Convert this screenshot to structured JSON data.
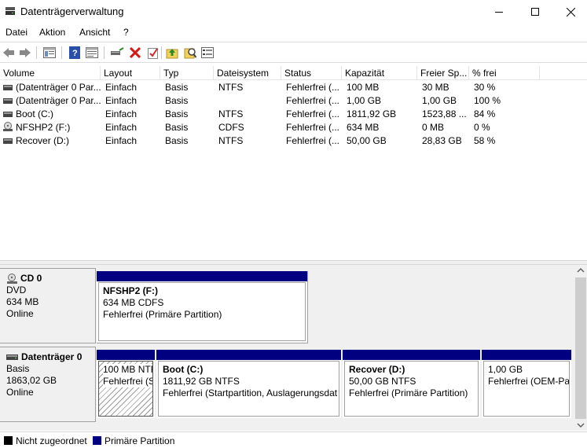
{
  "window": {
    "title": "Datenträgerverwaltung",
    "controls": [
      "minimize",
      "maximize",
      "close"
    ]
  },
  "menu": [
    "Datei",
    "Aktion",
    "Ansicht",
    "?"
  ],
  "toolbar": {
    "icons": [
      "back-icon",
      "forward-icon",
      "console-tree-icon",
      "help-icon",
      "properties-view-icon",
      "connect-disk-icon",
      "delete-icon",
      "check-icon",
      "rescan-up-icon",
      "search-icon",
      "settings-list-icon"
    ]
  },
  "volume_list": {
    "columns": [
      "Volume",
      "Layout",
      "Typ",
      "Dateisystem",
      "Status",
      "Kapazität",
      "Freier Sp...",
      "% frei"
    ],
    "rows": [
      {
        "icon": "drive-icon",
        "cells": [
          "(Datenträger 0 Par...",
          "Einfach",
          "Basis",
          "NTFS",
          "Fehlerfrei (...",
          "100 MB",
          "30 MB",
          "30 %"
        ]
      },
      {
        "icon": "drive-icon",
        "cells": [
          "(Datenträger 0 Par...",
          "Einfach",
          "Basis",
          "",
          "Fehlerfrei (...",
          "1,00 GB",
          "1,00 GB",
          "100 %"
        ]
      },
      {
        "icon": "drive-icon",
        "cells": [
          "Boot (C:)",
          "Einfach",
          "Basis",
          "NTFS",
          "Fehlerfrei (...",
          "1811,92 GB",
          "1523,88 ...",
          "84 %"
        ]
      },
      {
        "icon": "cd-drive-icon",
        "cells": [
          "NFSHP2 (F:)",
          "Einfach",
          "Basis",
          "CDFS",
          "Fehlerfrei (...",
          "634 MB",
          "0 MB",
          "0 %"
        ]
      },
      {
        "icon": "drive-icon",
        "cells": [
          "Recover (D:)",
          "Einfach",
          "Basis",
          "NTFS",
          "Fehlerfrei (...",
          "50,00 GB",
          "28,83 GB",
          "58 %"
        ]
      }
    ]
  },
  "disks": [
    {
      "name": "CD 0",
      "icon": "cd-icon",
      "lines": [
        "DVD",
        "634 MB",
        "Online"
      ],
      "partitions": [
        {
          "title": "NFSHP2  (F:)",
          "size": "634 MB CDFS",
          "status": "Fehlerfrei (Primäre Partition)"
        }
      ]
    },
    {
      "name": "Datenträger 0",
      "icon": "disk-icon",
      "lines": [
        "Basis",
        "1863,02 GB",
        "Online"
      ],
      "partitions": [
        {
          "title": "",
          "size": "100 MB NTFS",
          "status": "Fehlerfrei (S"
        },
        {
          "title": "Boot  (C:)",
          "size": "1811,92 GB NTFS",
          "status": "Fehlerfrei (Startpartition, Auslagerungsdat"
        },
        {
          "title": "Recover  (D:)",
          "size": "50,00 GB NTFS",
          "status": "Fehlerfrei (Primäre Partition)"
        },
        {
          "title": "",
          "size": "1,00 GB",
          "status": "Fehlerfrei (OEM-Pa"
        }
      ]
    }
  ],
  "legend": [
    {
      "label": "Nicht zugeordnet",
      "color": "#000000"
    },
    {
      "label": "Primäre Partition",
      "color": "#000080"
    }
  ]
}
